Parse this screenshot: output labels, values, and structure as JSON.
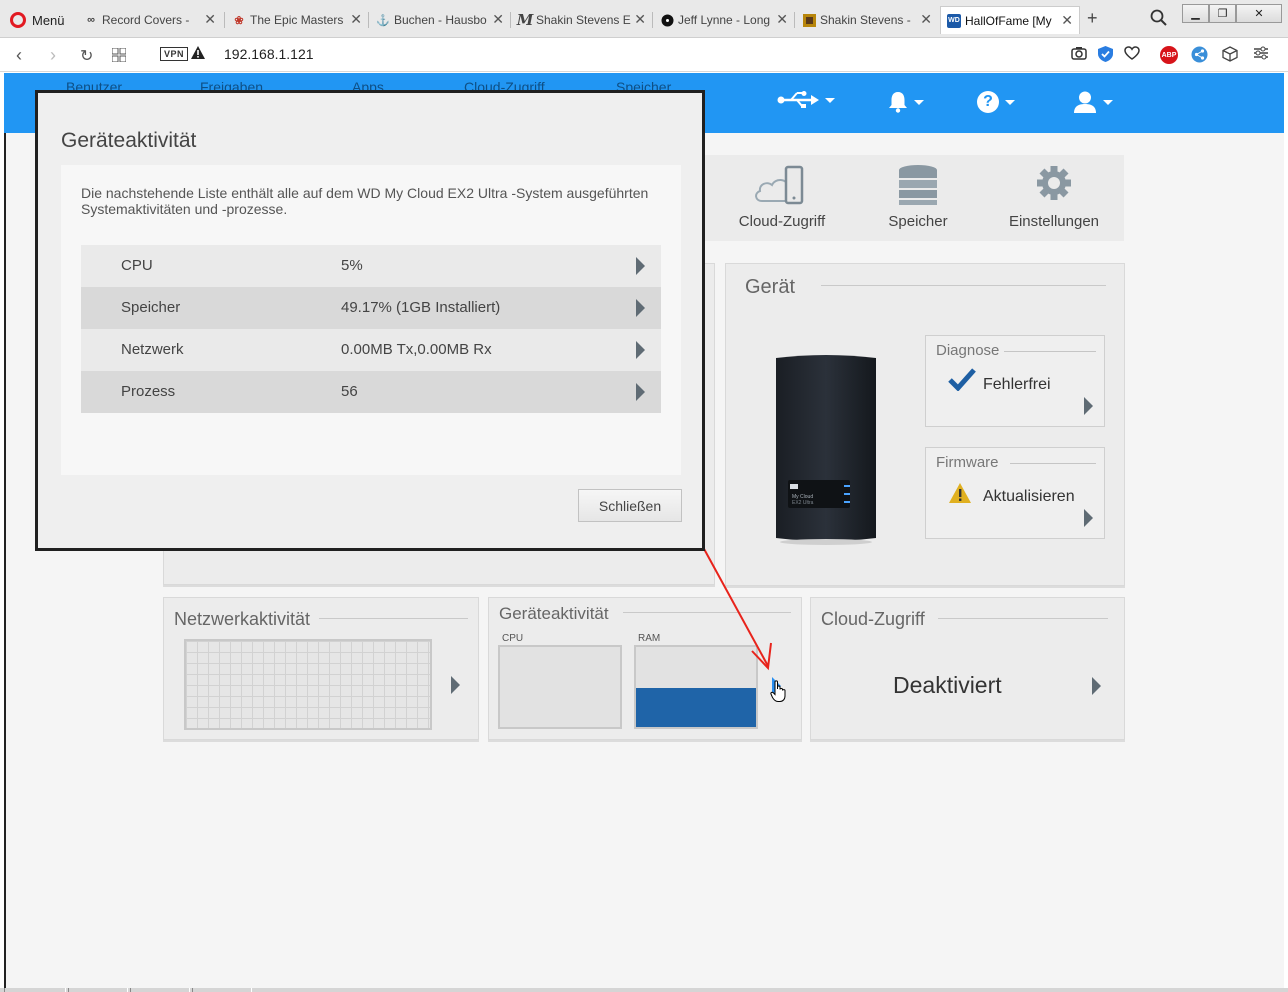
{
  "browser": {
    "menu_label": "Menü",
    "tabs": [
      {
        "label": "Record Covers - ",
        "icon": "infinity-icon"
      },
      {
        "label": "The Epic Masters",
        "icon": "rose-icon"
      },
      {
        "label": "Buchen - Hausbo",
        "icon": "anchor-icon"
      },
      {
        "label": "Shakin Stevens E",
        "icon": "m-logo-icon"
      },
      {
        "label": "Jeff Lynne - Long",
        "icon": "vinyl-icon"
      },
      {
        "label": "Shakin Stevens - ",
        "icon": "album-icon"
      },
      {
        "label": "HallOfFame [My",
        "icon": "wd-logo-icon",
        "active": true
      }
    ],
    "vpn_label": "VPN",
    "url": "192.168.1.121",
    "adblock_label": "ABP"
  },
  "header": {
    "ghost_items": [
      "Benutzer",
      "Freigaben",
      "Apps",
      "Cloud-Zugriff",
      "Speicher"
    ]
  },
  "nav": {
    "items": [
      {
        "label": "Cloud-Zugriff",
        "icon": "cloud-phone-icon"
      },
      {
        "label": "Speicher",
        "icon": "storage-stack-icon"
      },
      {
        "label": "Einstellungen",
        "icon": "gear-icon"
      }
    ]
  },
  "device_panel": {
    "title": "Gerät",
    "device_name": "My Cloud",
    "device_model": "EX2 Ultra",
    "diagnose": {
      "title": "Diagnose",
      "status": "Fehlerfrei"
    },
    "firmware": {
      "title": "Firmware",
      "status": "Aktualisieren"
    }
  },
  "network_panel": {
    "title": "Netzwerkaktivität"
  },
  "activity_panel": {
    "title": "Geräteaktivität",
    "cpu_label": "CPU",
    "ram_label": "RAM",
    "ram_usage_fraction": 0.4917
  },
  "cloud_panel": {
    "title": "Cloud-Zugriff",
    "status": "Deaktiviert"
  },
  "modal": {
    "title": "Geräteaktivität",
    "description": "Die nachstehende Liste enthält alle auf dem WD My Cloud EX2 Ultra -System ausgeführten Systemaktivitäten und -prozesse.",
    "rows": [
      {
        "label": "CPU",
        "value": "5%"
      },
      {
        "label": "Speicher",
        "value": "49.17% (1GB Installiert)"
      },
      {
        "label": "Netzwerk",
        "value": "0.00MB Tx,0.00MB Rx"
      },
      {
        "label": "Prozess",
        "value": "56"
      }
    ],
    "close_label": "Schließen"
  },
  "colors": {
    "header_blue": "#2196f3",
    "ram_bar": "#1f64a8",
    "check_blue": "#1e5fa3",
    "warning_yellow": "#e0b020",
    "annotation_red": "#e8231b"
  }
}
